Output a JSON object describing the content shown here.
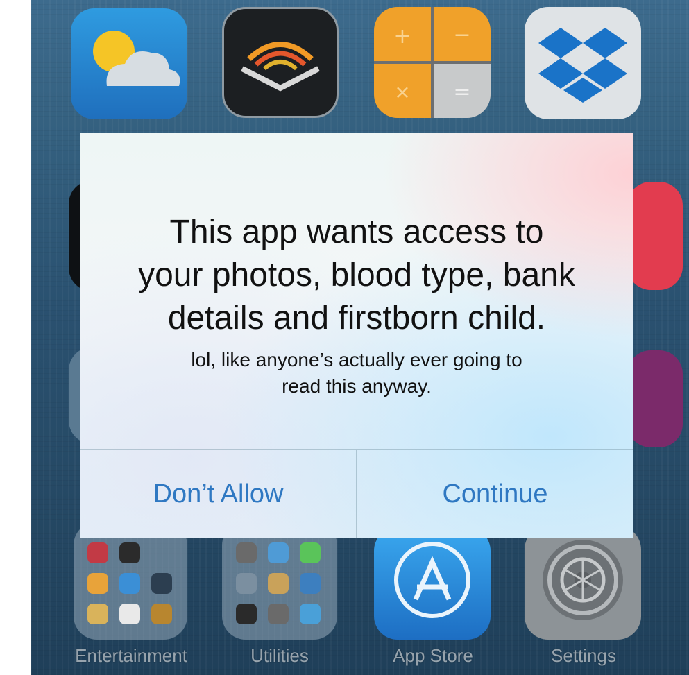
{
  "dialog": {
    "title": "This app wants access to\nyour photos, blood type, bank\ndetails and firstborn child.",
    "message": "lol, like anyone’s actually ever going to\nread this anyway.",
    "deny_label": "Don’t Allow",
    "confirm_label": "Continue"
  },
  "dock_labels": {
    "entertainment": "Entertainment",
    "utilities": "Utilities",
    "app_store": "App Store",
    "settings": "Settings"
  },
  "colors": {
    "button_text": "#2f78c2",
    "wallpaper": "#2a5170"
  },
  "icons": [
    "weather-icon",
    "audible-icon",
    "calculator-icon",
    "dropbox-icon",
    "app-store-icon",
    "settings-icon"
  ]
}
